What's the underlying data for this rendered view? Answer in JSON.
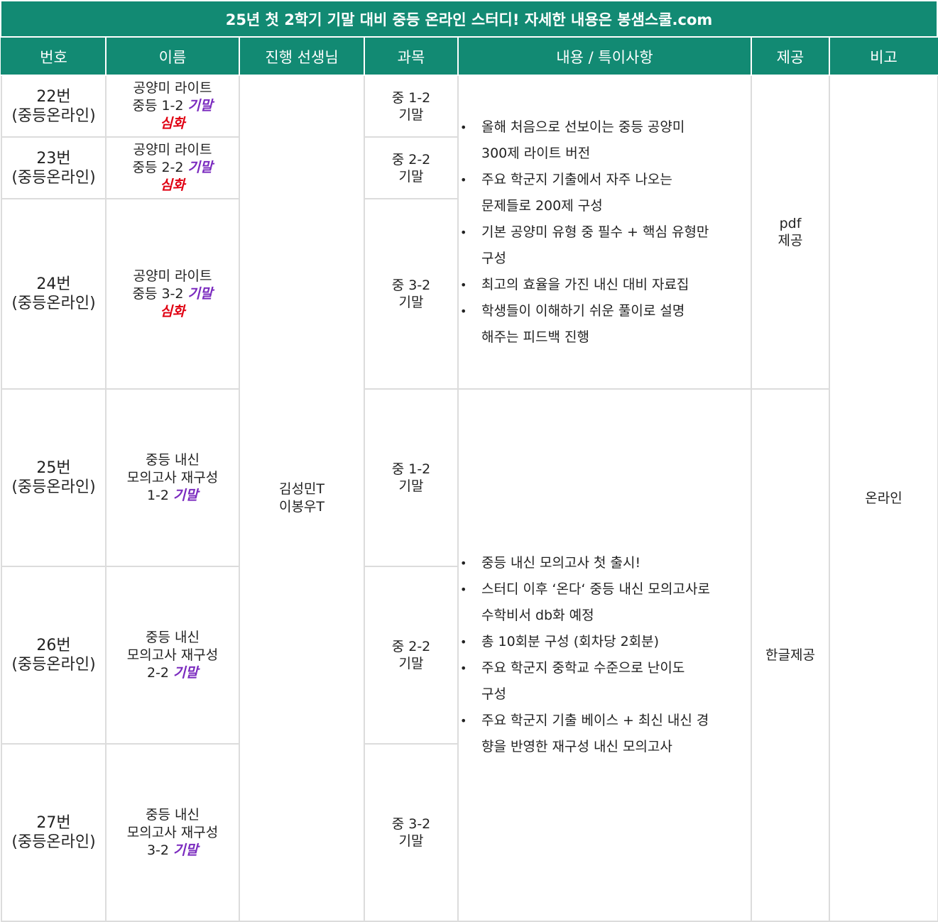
{
  "banner": {
    "title": "25년 첫 2학기 기말 대비 중등 온라인 스터디! 자세한 내용은 봉샘스쿨.com"
  },
  "headers": [
    "번호",
    "이름",
    "진행 선생님",
    "과목",
    "내용 / 특이사항",
    "제공",
    "비고"
  ],
  "teachers": {
    "line1": "김성민T",
    "line2": "이봉우T"
  },
  "remark": "온라인",
  "rows": [
    {
      "num": "22번",
      "tag": "(중등온라인)",
      "name1": "공양미 라이트",
      "name2a": "중등 1-2 ",
      "name2b": "기말",
      "name3": "심화",
      "subj1": "중 1-2",
      "subj2": "기말"
    },
    {
      "num": "23번",
      "tag": "(중등온라인)",
      "name1": "공양미 라이트",
      "name2a": "중등 2-2 ",
      "name2b": "기말",
      "name3": "심화",
      "subj1": "중 2-2",
      "subj2": "기말"
    },
    {
      "num": "24번",
      "tag": "(중등온라인)",
      "name1": "공양미 라이트",
      "name2a": "중등 3-2 ",
      "name2b": "기말",
      "name3": "심화",
      "subj1": "중 3-2",
      "subj2": "기말"
    },
    {
      "num": "25번",
      "tag": "(중등온라인)",
      "name1": "중등 내신",
      "name2": "모의고사 재구성",
      "name3a": "1-2 ",
      "name3b": "기말",
      "subj1": "중 1-2",
      "subj2": "기말"
    },
    {
      "num": "26번",
      "tag": "(중등온라인)",
      "name1": "중등 내신",
      "name2": "모의고사 재구성",
      "name3a": "2-2 ",
      "name3b": "기말",
      "subj1": "중 2-2",
      "subj2": "기말"
    },
    {
      "num": "27번",
      "tag": "(중등온라인)",
      "name1": "중등 내신",
      "name2": "모의고사 재구성",
      "name3a": "3-2 ",
      "name3b": "기말",
      "subj1": "중 3-2",
      "subj2": "기말"
    }
  ],
  "group1": {
    "provide1": "pdf",
    "provide2": "제공",
    "bullets": [
      [
        "올해 처음으로 선보이는 중등 공양미",
        "300제 라이트 버전"
      ],
      [
        "주요 학군지 기출에서 자주 나오는",
        "문제들로 200제 구성"
      ],
      [
        "기본 공양미 유형 중 필수 + 핵심 유형만",
        "구성"
      ],
      [
        "최고의 효율을 가진 내신 대비 자료집"
      ],
      [
        "학생들이 이해하기 쉬운 풀이로 설명",
        "해주는 피드백 진행"
      ]
    ]
  },
  "group2": {
    "provide": "한글제공",
    "bullets": [
      [
        "중등 내신 모의고사 첫 출시!"
      ],
      [
        "스터디 이후 ‘온다‘ 중등 내신 모의고사로",
        "수학비서 db화 예정"
      ],
      [
        "총 10회분 구성 (회차당 2회분)"
      ],
      [
        "주요 학군지 중학교 수준으로 난이도",
        "구성"
      ],
      [
        "주요 학군지 기출 베이스 + 최신 내신 경",
        "향을 반영한 재구성 내신 모의고사"
      ]
    ]
  }
}
